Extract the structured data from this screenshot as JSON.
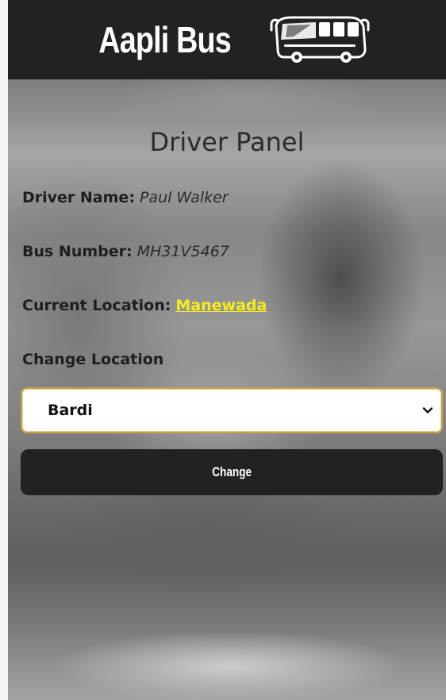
{
  "header": {
    "app_title": "Aapli Bus",
    "logo_icon": "bus-icon"
  },
  "panel": {
    "title": "Driver Panel",
    "driver_name_label": "Driver Name:",
    "driver_name_value": "Paul Walker",
    "bus_number_label": "Bus Number:",
    "bus_number_value": "MH31V5467",
    "current_location_label": "Current Location:",
    "current_location_value": "Manewada",
    "change_location_label": "Change Location",
    "location_select": {
      "selected": "Bardi",
      "icon": "chevron-down-icon"
    },
    "change_button_label": "Change"
  },
  "colors": {
    "header_bg": "#222222",
    "link_yellow": "#f5ee1a",
    "select_border": "#c8a24a",
    "button_bg": "#222222"
  }
}
